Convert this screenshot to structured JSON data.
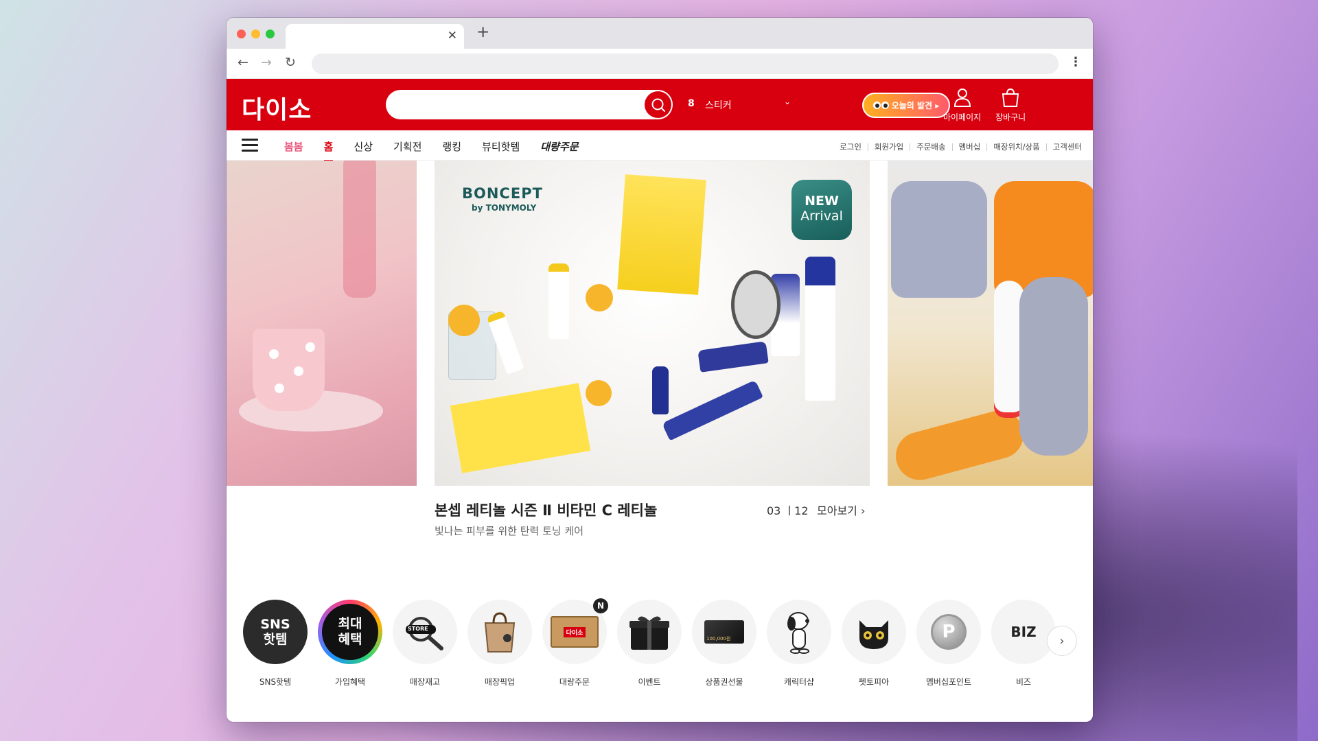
{
  "header": {
    "logo": "다이소",
    "rank_number": "8",
    "rank_keyword": "스티커",
    "today_label": "오늘의 발견 ▸",
    "mypage_label": "마이페이지",
    "cart_label": "장바구니"
  },
  "gnb": {
    "menu": [
      "봄봄",
      "홈",
      "신상",
      "기획전",
      "랭킹",
      "뷰티핫템",
      "대량주문"
    ],
    "util": [
      "로그인",
      "회원가입",
      "주문배송",
      "멤버십",
      "매장위치/상품",
      "고객센터"
    ]
  },
  "hero": {
    "brand": "BONCEPT",
    "brand_sub": "by TONYMOLY",
    "badge_line1": "NEW",
    "badge_line2": "Arrival",
    "title": "본셉 레티놀 시즌 Ⅱ 비타민 C 레티놀",
    "subtitle": "빛나는 피부를 위한 탄력 토닝 케어",
    "counter": "03 ㅣ12",
    "more": "모아보기 ›"
  },
  "quick_menu": [
    {
      "label": "SNS핫템",
      "icon": "sns-hot-icon",
      "badge_text": "SNS 핫템"
    },
    {
      "label": "가입혜택",
      "icon": "benefit-icon",
      "badge_text": "최대 혜택"
    },
    {
      "label": "매장재고",
      "icon": "store-search-icon",
      "badge_text": "STORE"
    },
    {
      "label": "매장픽업",
      "icon": "shopping-bag-icon"
    },
    {
      "label": "대량주문",
      "icon": "box-icon",
      "badge_text": "다이소"
    },
    {
      "label": "이벤트",
      "icon": "gift-icon"
    },
    {
      "label": "상품권선물",
      "icon": "gift-card-icon",
      "badge_text": "100,000원"
    },
    {
      "label": "캐릭터샵",
      "icon": "snoopy-icon"
    },
    {
      "label": "펫토피아",
      "icon": "cat-icon"
    },
    {
      "label": "멤버십포인트",
      "icon": "point-coin-icon",
      "badge_text": "P"
    },
    {
      "label": "비즈",
      "icon": "biz-icon",
      "badge_text": "BIZ"
    }
  ],
  "colors": {
    "brand_red": "#d8000f",
    "spring_pink": "#e8577c"
  }
}
